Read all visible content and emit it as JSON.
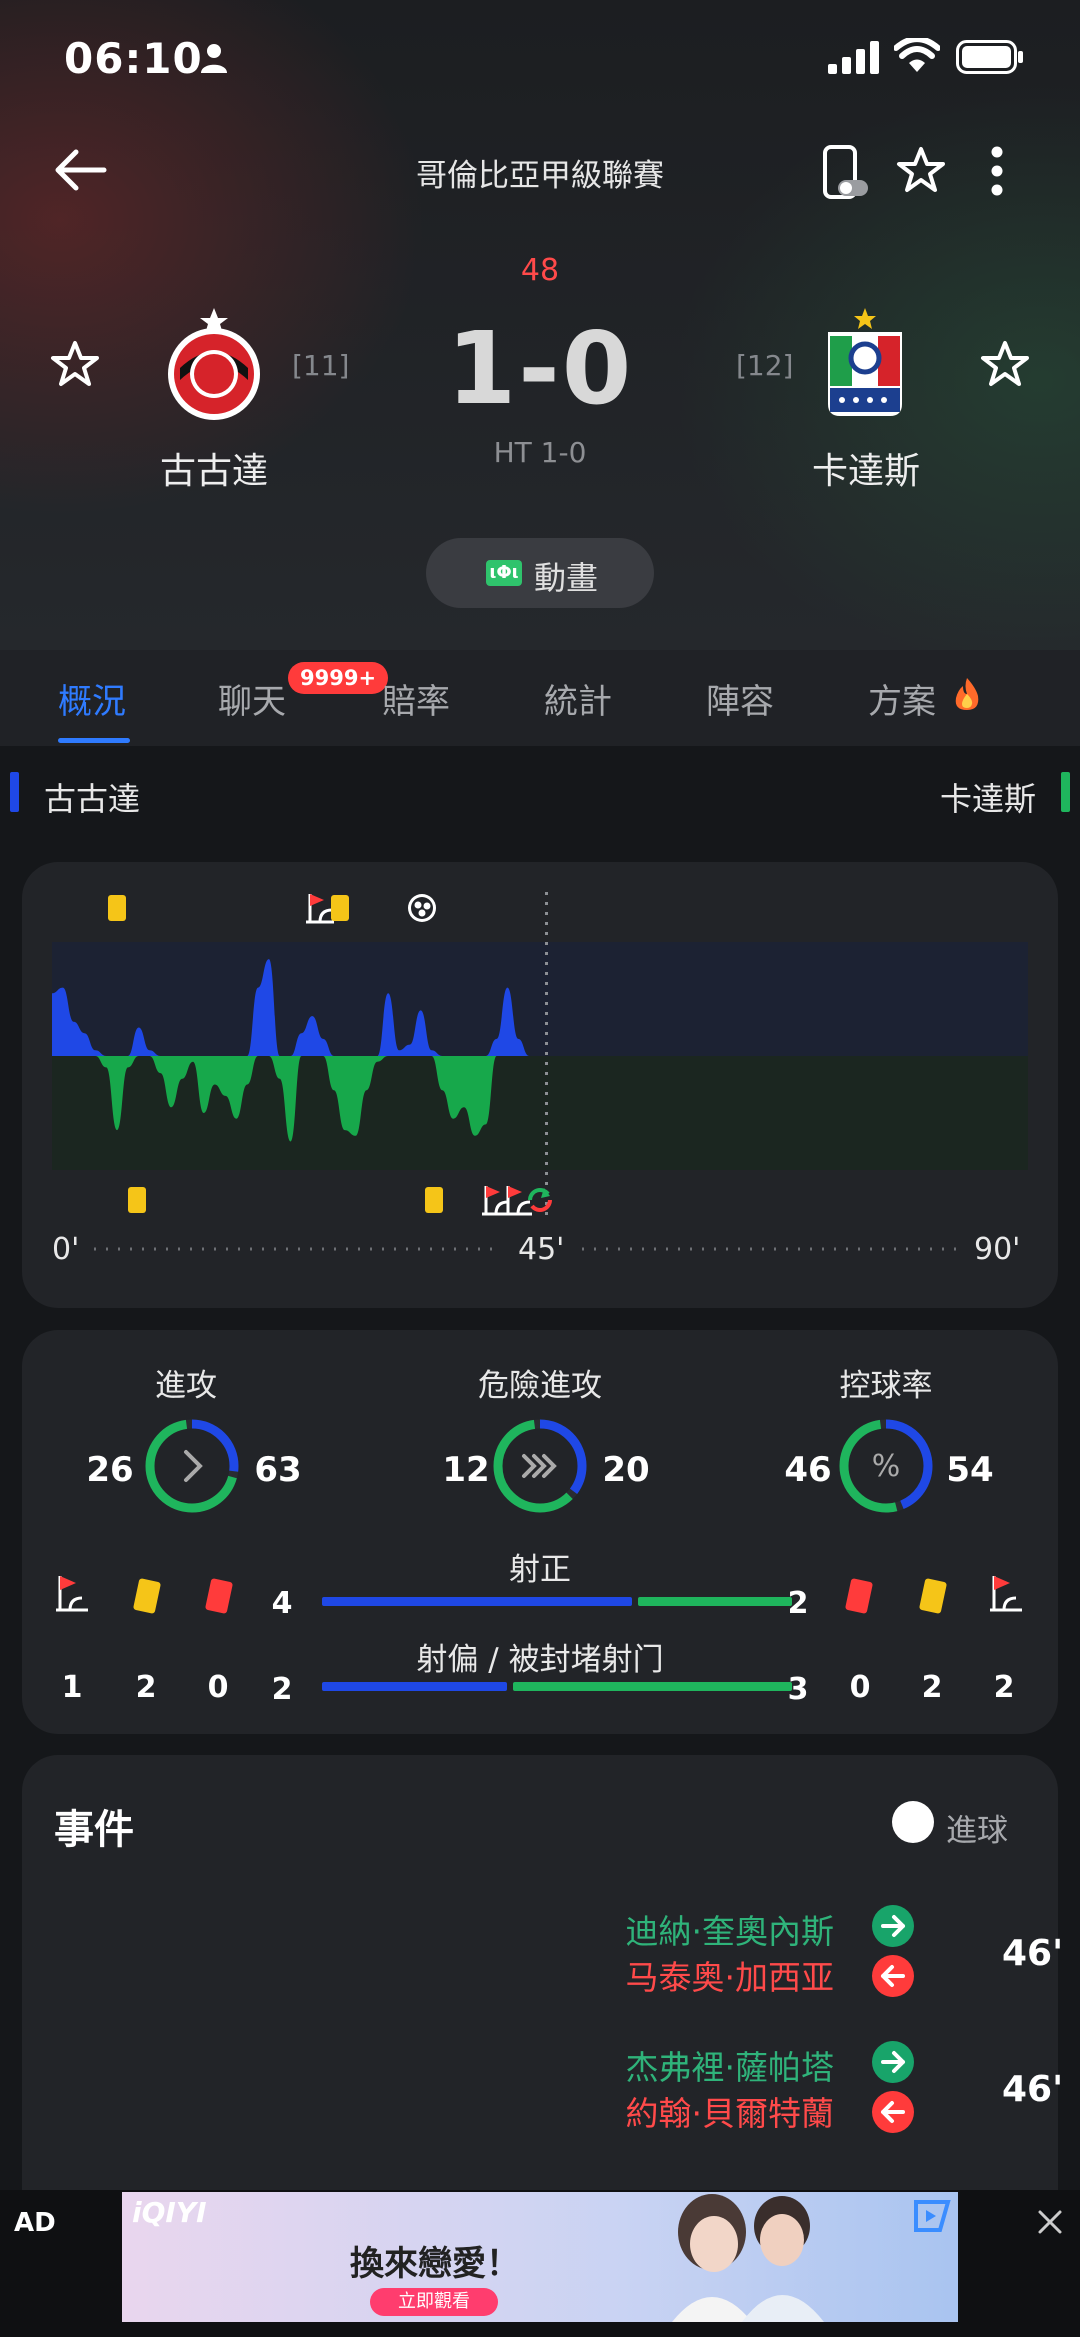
{
  "status_bar": {
    "time": "06:10"
  },
  "top_nav": {
    "title": "哥倫比亞甲級聯賽"
  },
  "match": {
    "minute": "48",
    "score": "1-0",
    "halftime": "HT 1-0",
    "home": {
      "name": "古古達",
      "rank": "[11]"
    },
    "away": {
      "name": "卡達斯",
      "rank": "[12]"
    },
    "animation_button": "動畫"
  },
  "tabs": [
    {
      "label": "概況",
      "active": true
    },
    {
      "label": "聊天",
      "badge": "9999+"
    },
    {
      "label": "賠率"
    },
    {
      "label": "統計"
    },
    {
      "label": "陣容"
    },
    {
      "label": "方案"
    }
  ],
  "teams_row": {
    "home": "古古達",
    "away": "卡達斯"
  },
  "timeline": {
    "labels": [
      "0'",
      "45'",
      "90'"
    ],
    "current_minute": 48,
    "colors": {
      "home": "#1f48e6",
      "away": "#1fb55d"
    },
    "momentum": [
      {
        "minute": 0,
        "value": 0.55
      },
      {
        "minute": 1,
        "value": 0.6
      },
      {
        "minute": 2,
        "value": 0.3
      },
      {
        "minute": 3,
        "value": 0.2
      },
      {
        "minute": 4,
        "value": 0.05
      },
      {
        "minute": 5,
        "value": -0.1
      },
      {
        "minute": 6,
        "value": -0.65
      },
      {
        "minute": 7,
        "value": -0.1
      },
      {
        "minute": 8,
        "value": 0.25
      },
      {
        "minute": 9,
        "value": 0.05
      },
      {
        "minute": 10,
        "value": -0.15
      },
      {
        "minute": 11,
        "value": -0.45
      },
      {
        "minute": 12,
        "value": -0.2
      },
      {
        "minute": 13,
        "value": -0.05
      },
      {
        "minute": 14,
        "value": -0.5
      },
      {
        "minute": 15,
        "value": -0.25
      },
      {
        "minute": 16,
        "value": -0.35
      },
      {
        "minute": 17,
        "value": -0.55
      },
      {
        "minute": 18,
        "value": -0.25
      },
      {
        "minute": 19,
        "value": 0.6
      },
      {
        "minute": 20,
        "value": 0.85
      },
      {
        "minute": 21,
        "value": -0.2
      },
      {
        "minute": 22,
        "value": -0.75
      },
      {
        "minute": 23,
        "value": 0.2
      },
      {
        "minute": 24,
        "value": 0.35
      },
      {
        "minute": 25,
        "value": 0.15
      },
      {
        "minute": 26,
        "value": -0.3
      },
      {
        "minute": 27,
        "value": -0.65
      },
      {
        "minute": 28,
        "value": -0.7
      },
      {
        "minute": 29,
        "value": -0.3
      },
      {
        "minute": 30,
        "value": -0.05
      },
      {
        "minute": 31,
        "value": 0.55
      },
      {
        "minute": 32,
        "value": 0.05
      },
      {
        "minute": 33,
        "value": 0.1
      },
      {
        "minute": 34,
        "value": 0.4
      },
      {
        "minute": 35,
        "value": 0.05
      },
      {
        "minute": 36,
        "value": -0.3
      },
      {
        "minute": 37,
        "value": -0.55
      },
      {
        "minute": 38,
        "value": -0.45
      },
      {
        "minute": 39,
        "value": -0.7
      },
      {
        "minute": 40,
        "value": -0.6
      },
      {
        "minute": 41,
        "value": 0.15
      },
      {
        "minute": 42,
        "value": 0.6
      },
      {
        "minute": 43,
        "value": 0.15
      },
      {
        "minute": 44,
        "value": 0
      },
      {
        "minute": 48,
        "value": 0
      }
    ],
    "home_events": [
      {
        "minute": 5,
        "type": "yellow"
      },
      {
        "minute": 24,
        "type": "corner"
      },
      {
        "minute": 25,
        "type": "yellow"
      },
      {
        "minute": 34,
        "type": "goal"
      }
    ],
    "away_events": [
      {
        "minute": 7,
        "type": "yellow"
      },
      {
        "minute": 35,
        "type": "yellow"
      },
      {
        "minute": 41,
        "type": "corner"
      },
      {
        "minute": 43,
        "type": "corner"
      },
      {
        "minute": 45,
        "type": "substitution"
      }
    ]
  },
  "stats": {
    "attack": {
      "label": "進攻",
      "home": 26,
      "away": 63
    },
    "dangerous_attack": {
      "label": "危險進攻",
      "home": 12,
      "away": 20
    },
    "possession": {
      "label": "控球率",
      "home": 46,
      "away": 54
    },
    "shots_on_target": {
      "label": "射正",
      "home": 4,
      "away": 2
    },
    "shots_off_target": {
      "label": "射偏 / 被封堵射门",
      "home": 2,
      "away": 3
    },
    "home_counts": {
      "corners": 1,
      "yellow": 2,
      "red": 0
    },
    "away_counts": {
      "red": 0,
      "yellow": 2,
      "corners": 2
    },
    "colors": {
      "home": "#1f48e6",
      "away": "#1fb55d",
      "yellow": "#f5c518",
      "red": "#ff3b3b"
    }
  },
  "events": {
    "title": "事件",
    "legend": "進球",
    "items": [
      {
        "minute": "46'",
        "in": "迪納·奎奧內斯",
        "out": "马泰奥·加西亚"
      },
      {
        "minute": "46'",
        "in": "杰弗裡·薩帕塔",
        "out": "約翰·貝爾特蘭"
      }
    ]
  },
  "ad": {
    "label": "AD",
    "logo": "iQIYI",
    "headline": "換來戀愛！",
    "cta": "立即觀看"
  }
}
